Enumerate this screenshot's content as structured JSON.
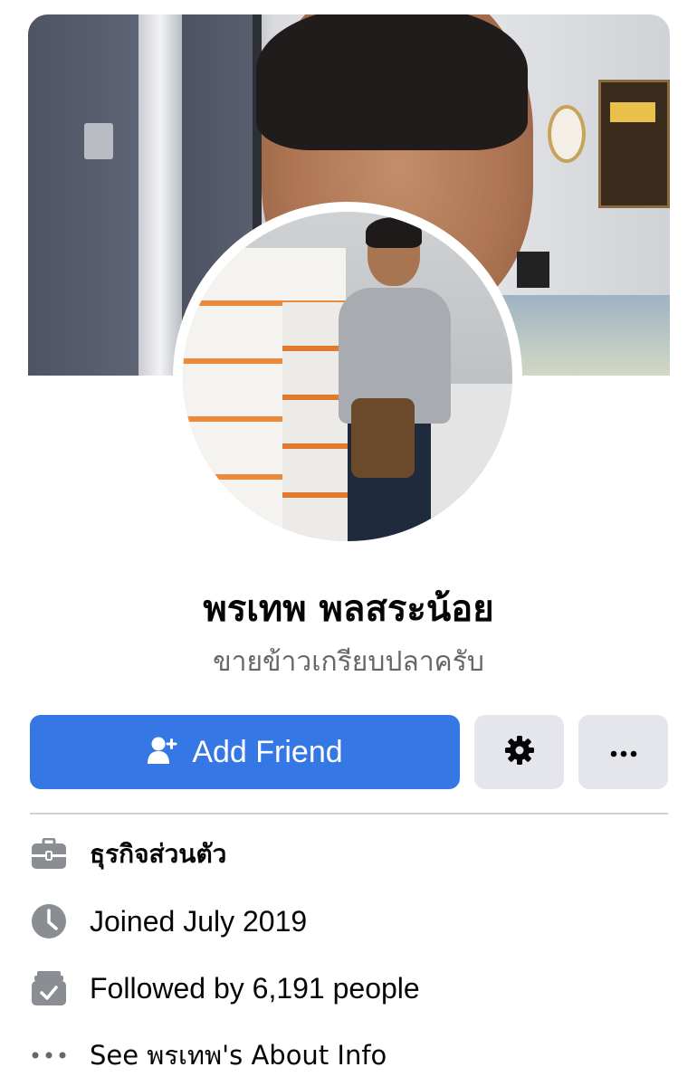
{
  "profile": {
    "name": "พรเทพ พลสระน้อย",
    "bio": "ขายข้าวเกรียบปลาครับ"
  },
  "actions": {
    "add_friend_label": "Add Friend"
  },
  "info": {
    "work": "ธุรกิจส่วนตัว",
    "joined": "Joined July 2019",
    "followers": "Followed by 6,191 people",
    "about": "See พรเทพ's About Info"
  },
  "icons": {
    "add_friend": "person-plus-icon",
    "settings": "gear-icon",
    "more": "more-dots-icon",
    "work": "briefcase-icon",
    "joined": "clock-icon",
    "followers": "followers-check-icon",
    "about": "ellipsis-icon"
  },
  "colors": {
    "primary_button": "#3578e5",
    "secondary_button": "#e4e6eb",
    "icon_gray": "#8a8d91",
    "secondary_text": "#65676b"
  }
}
